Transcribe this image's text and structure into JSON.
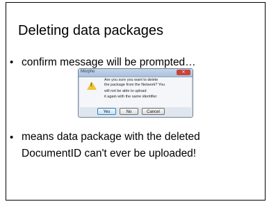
{
  "slide": {
    "title": "Deleting data packages",
    "bullets": [
      {
        "text": "confirm message will be prompted…"
      },
      {
        "lines": [
          "means data package with the deleted",
          "DocumentID can't ever be uploaded!"
        ]
      }
    ]
  },
  "dialog": {
    "title": "Morpho",
    "close_glyph": "✕",
    "icon": "warning-icon",
    "message_lines": [
      "Are you sure you want to delete",
      "the package from the Network? You",
      "will not be able to upload",
      "it again with the same identifier"
    ],
    "buttons": {
      "yes": "Yes",
      "no": "No",
      "cancel": "Cancel"
    }
  },
  "colors": {
    "accent": "#3c7fb1",
    "warning": "#f2c230",
    "close": "#c9443a"
  }
}
